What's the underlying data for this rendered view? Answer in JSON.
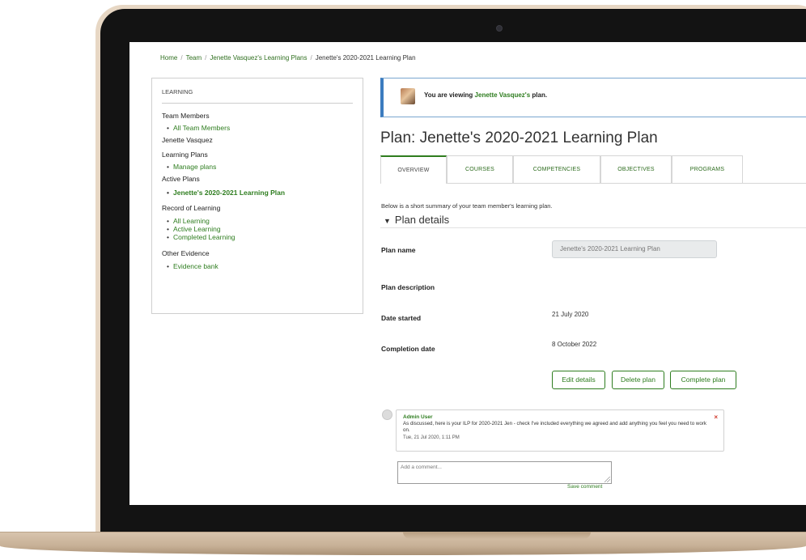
{
  "breadcrumb": [
    "Home",
    "Team",
    "Jenette Vasquez's Learning Plans",
    "Jenette's 2020-2021 Learning Plan"
  ],
  "sidebar": {
    "heading": "LEARNING",
    "team_members": "Team Members",
    "all_team_members": "All Team Members",
    "person": "Jenette Vasquez",
    "learning_plans": "Learning Plans",
    "manage_plans": "Manage plans",
    "active_plans": "Active Plans",
    "active_plan": "Jenette's 2020-2021 Learning Plan",
    "record": "Record of Learning",
    "all_learning": "All Learning",
    "active_learning": "Active Learning",
    "completed_learning": "Completed Learning",
    "other_evidence": "Other Evidence",
    "evidence_bank": "Evidence bank"
  },
  "notice": {
    "prefix": "You are viewing ",
    "person": "Jenette Vasquez's",
    "suffix": " plan."
  },
  "page_title": "Plan: Jenette's 2020-2021 Learning Plan",
  "tabs": [
    "OVERVIEW",
    "COURSES",
    "COMPETENCIES",
    "OBJECTIVES",
    "PROGRAMS"
  ],
  "summary": "Below is a short summary of your team member's learning plan.",
  "section_title": "Plan details",
  "fields": {
    "plan_name_label": "Plan name",
    "plan_name_value": "Jenette's 2020-2021 Learning Plan",
    "plan_description_label": "Plan description",
    "date_started_label": "Date started",
    "date_started_value": "21 July 2020",
    "completion_label": "Completion date",
    "completion_value": "8 October 2022"
  },
  "buttons": {
    "edit": "Edit details",
    "delete": "Delete plan",
    "complete": "Complete plan"
  },
  "comment": {
    "author": "Admin User",
    "text": "As discussed, here is your ILP for 2020-2021 Jen - check I've included everything we agreed and add anything you feel you need to work on.",
    "time": "Tue, 21 Jul 2020, 1:11 PM",
    "delete_icon": "×"
  },
  "comment_input": {
    "placeholder": "Add a comment...",
    "save": "Save comment"
  },
  "colors": {
    "link_green": "#2e7d1f",
    "notice_blue": "#3c7cbf"
  }
}
